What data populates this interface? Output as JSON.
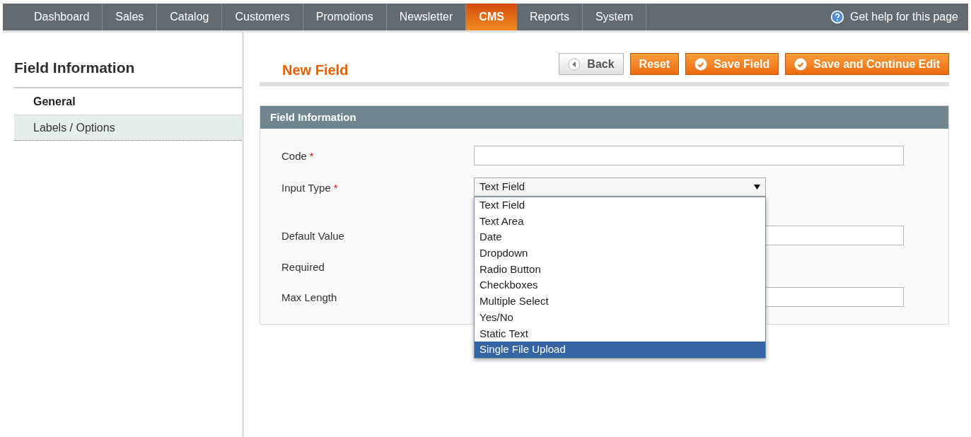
{
  "nav": {
    "items": [
      {
        "label": "Dashboard",
        "selected": false
      },
      {
        "label": "Sales",
        "selected": false
      },
      {
        "label": "Catalog",
        "selected": false
      },
      {
        "label": "Customers",
        "selected": false
      },
      {
        "label": "Promotions",
        "selected": false
      },
      {
        "label": "Newsletter",
        "selected": false
      },
      {
        "label": "CMS",
        "selected": true
      },
      {
        "label": "Reports",
        "selected": false
      },
      {
        "label": "System",
        "selected": false
      }
    ],
    "help": "Get help for this page"
  },
  "sidebar": {
    "title": "Field Information",
    "tabs": [
      {
        "label": "General",
        "selected": true
      },
      {
        "label": "Labels / Options",
        "selected": false
      }
    ]
  },
  "page_title": "New Field",
  "buttons": [
    {
      "label": "Back",
      "kind": "back"
    },
    {
      "label": "Reset",
      "kind": "plain"
    },
    {
      "label": "Save Field",
      "kind": "save"
    },
    {
      "label": "Save and Continue Edit",
      "kind": "save"
    }
  ],
  "section": {
    "title": "Field Information",
    "fields": [
      {
        "label": "Code",
        "required_mark": "*",
        "kind": "text"
      },
      {
        "label": "Input Type",
        "required_mark": "*",
        "kind": "select",
        "value": "Text Field",
        "open": true,
        "options": [
          {
            "label": "Text Field",
            "highlighted": false
          },
          {
            "label": "Text Area",
            "highlighted": false
          },
          {
            "label": "Date",
            "highlighted": false
          },
          {
            "label": "Dropdown",
            "highlighted": false
          },
          {
            "label": "Radio Button",
            "highlighted": false
          },
          {
            "label": "Checkboxes",
            "highlighted": false
          },
          {
            "label": "Multiple Select",
            "highlighted": false
          },
          {
            "label": "Yes/No",
            "highlighted": false
          },
          {
            "label": "Static Text",
            "highlighted": false
          },
          {
            "label": "Single File Upload",
            "highlighted": true
          }
        ]
      },
      {
        "label": "Default Value",
        "kind": "text"
      },
      {
        "label": "Required"
      },
      {
        "label": "Max Length",
        "kind": "text"
      }
    ]
  }
}
